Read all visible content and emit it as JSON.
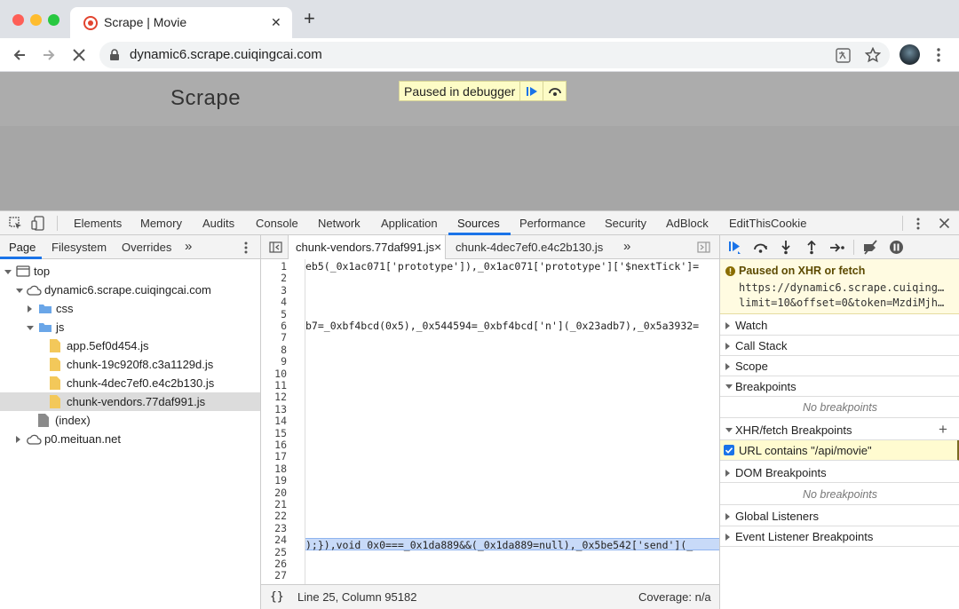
{
  "browser": {
    "tab_title": "Scrape | Movie",
    "new_tab": "+",
    "close_tab": "✕",
    "url": "dynamic6.scrape.cuiqingcai.com"
  },
  "page": {
    "brand": "Scrape",
    "debugger_banner": "Paused in debugger"
  },
  "devtools": {
    "main_tabs": [
      "Elements",
      "Memory",
      "Audits",
      "Console",
      "Network",
      "Application",
      "Sources",
      "Performance",
      "Security",
      "AdBlock",
      "EditThisCookie"
    ],
    "active_tab": "Sources",
    "navigator_tabs": [
      "Page",
      "Filesystem",
      "Overrides"
    ],
    "more_tabs": "»",
    "tree": [
      {
        "label": "top",
        "depth": 0
      },
      {
        "label": "dynamic6.scrape.cuiqingcai.com",
        "depth": 1
      },
      {
        "label": "css",
        "depth": 2
      },
      {
        "label": "js",
        "depth": 2
      },
      {
        "label": "app.5ef0d454.js",
        "depth": 3
      },
      {
        "label": "chunk-19c920f8.c3a1129d.js",
        "depth": 3
      },
      {
        "label": "chunk-4dec7ef0.e4c2b130.js",
        "depth": 3
      },
      {
        "label": "chunk-vendors.77daf991.js",
        "depth": 3,
        "selected": true
      },
      {
        "label": "(index)",
        "depth": 2
      },
      {
        "label": "p0.meituan.net",
        "depth": 1
      }
    ],
    "editor_tabs": [
      "chunk-vendors.77daf991.js",
      "chunk-4dec7ef0.e4c2b130.js"
    ],
    "editor_tab_close": "×",
    "line_numbers": [
      "1",
      "2",
      "3",
      "4",
      "5",
      "6",
      "7",
      "8",
      "9",
      "10",
      "11",
      "12",
      "13",
      "14",
      "15",
      "16",
      "17",
      "18",
      "19",
      "20",
      "21",
      "22",
      "23",
      "24",
      "25",
      "26",
      "27"
    ],
    "code_line_1": "eb5(_0x1ac071['prototype']),_0x1ac071['prototype']['$nextTick']=",
    "code_line_6": "b7=_0xbf4bcd(0x5),_0x544594=_0xbf4bcd['n'](_0x23adb7),_0x5a3932=",
    "code_line_25": ");}),void 0x0===_0x1da889&&(_0x1da889=null),_0x5be542['send'](_",
    "status": {
      "format": "{}",
      "position": "Line 25, Column 95182",
      "coverage": "Coverage: n/a"
    },
    "sidebar": {
      "paused_title": "Paused on XHR or fetch",
      "paused_url_1": "https://dynamic6.scrape.cuiqing…",
      "paused_url_2": "limit=10&offset=0&token=MzdiMjh…",
      "watch": "Watch",
      "call_stack": "Call Stack",
      "scope": "Scope",
      "breakpoints": "Breakpoints",
      "no_breakpoints": "No breakpoints",
      "xhr_breakpoints": "XHR/fetch Breakpoints",
      "add": "+",
      "xhr_rule": "URL contains \"/api/movie\"",
      "dom_breakpoints": "DOM Breakpoints",
      "dom_no_breakpoints": "No breakpoints",
      "global_listeners": "Global Listeners",
      "event_listener_breakpoints": "Event Listener Breakpoints"
    }
  },
  "colors": {
    "accent": "#1a73e8",
    "paused_bg": "#fdfcc6",
    "highlight_line": "#c8daf8"
  }
}
